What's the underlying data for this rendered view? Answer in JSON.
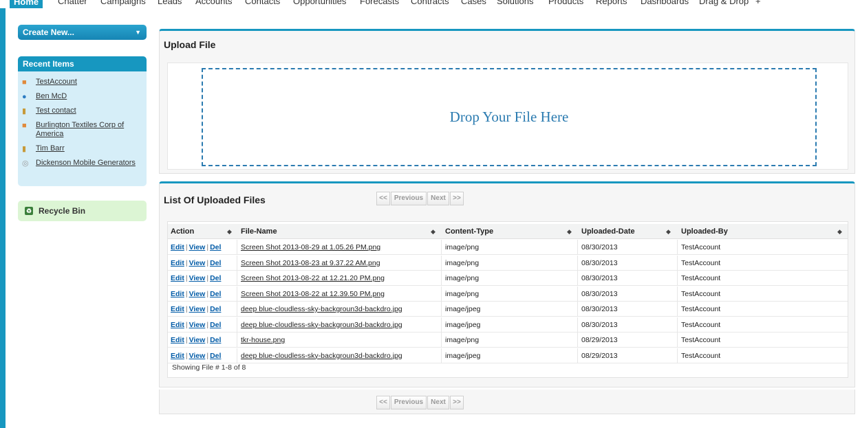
{
  "nav": {
    "tabs": [
      "Home",
      "Chatter",
      "Campaigns",
      "Leads",
      "Accounts",
      "Contacts",
      "Opportunities",
      "Forecasts",
      "Contracts",
      "Cases",
      "Solutions",
      "Products",
      "Reports",
      "Dashboards",
      "Drag & Drop",
      "+"
    ]
  },
  "sidebar": {
    "create_new": "Create New...",
    "recent_title": "Recent Items",
    "recent_items": [
      {
        "label": "TestAccount",
        "icon": "account-icon"
      },
      {
        "label": "Ben McD",
        "icon": "user-icon"
      },
      {
        "label": "Test contact",
        "icon": "contact-icon"
      },
      {
        "label": "Burlington Textiles Corp of America",
        "icon": "account-icon"
      },
      {
        "label": "Tim Barr",
        "icon": "contact-icon"
      },
      {
        "label": "Dickenson Mobile Generators",
        "icon": "lead-icon"
      }
    ],
    "recycle_bin": "Recycle Bin"
  },
  "upload": {
    "title": "Upload File",
    "drop_text": "Drop Your File Here"
  },
  "files": {
    "title": "List Of Uploaded Files",
    "pager": {
      "first": "<<",
      "prev": "Previous",
      "next": "Next",
      "last": ">>"
    },
    "columns": [
      "Action",
      "File-Name",
      "Content-Type",
      "Uploaded-Date",
      "Uploaded-By"
    ],
    "actions": {
      "edit": "Edit",
      "view": "View",
      "del": "Del",
      "sep": "|"
    },
    "rows": [
      {
        "name": "Screen Shot 2013-08-29 at 1.05.26 PM.png",
        "type": "image/png",
        "date": "08/30/2013",
        "by": "TestAccount"
      },
      {
        "name": "Screen Shot 2013-08-23 at 9.37.22 AM.png",
        "type": "image/png",
        "date": "08/30/2013",
        "by": "TestAccount"
      },
      {
        "name": "Screen Shot 2013-08-22 at 12.21.20 PM.png",
        "type": "image/png",
        "date": "08/30/2013",
        "by": "TestAccount"
      },
      {
        "name": "Screen Shot 2013-08-22 at 12.39.50 PM.png",
        "type": "image/png",
        "date": "08/30/2013",
        "by": "TestAccount"
      },
      {
        "name": "deep blue-cloudless-sky-backgroun3d-backdro.jpg",
        "type": "image/jpeg",
        "date": "08/30/2013",
        "by": "TestAccount"
      },
      {
        "name": "deep blue-cloudless-sky-backgroun3d-backdro.jpg",
        "type": "image/jpeg",
        "date": "08/30/2013",
        "by": "TestAccount"
      },
      {
        "name": "tkr-house.png",
        "type": "image/png",
        "date": "08/29/2013",
        "by": "TestAccount"
      },
      {
        "name": "deep blue-cloudless-sky-backgroun3d-backdro.jpg",
        "type": "image/jpeg",
        "date": "08/29/2013",
        "by": "TestAccount"
      }
    ],
    "showing": "Showing File # 1-8 of 8"
  },
  "colors": {
    "accent": "#1797c0",
    "link": "#015ba7",
    "drop": "#2b7bb0"
  }
}
